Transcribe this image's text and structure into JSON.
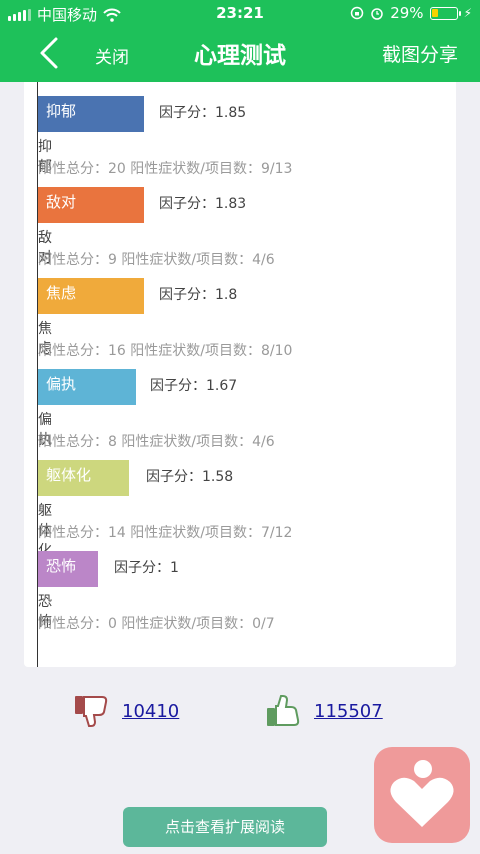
{
  "status_bar": {
    "carrier": "中国移动",
    "time": "23:21",
    "battery": "29%",
    "battery_level": 0.29
  },
  "nav": {
    "close_label": "关闭",
    "title": "心理测试",
    "share_label": "截图分享"
  },
  "factors": [
    {
      "bar_label": "抑郁",
      "score_text": "因子分：1.85",
      "name": "抑郁",
      "stats": "阳性总分：20    阳性症状数/项目数：9/13",
      "color": "#4a73b1",
      "bar_fraction": 0.2333
    },
    {
      "bar_label": "敌对",
      "score_text": "因子分：1.83",
      "name": "敌对",
      "stats": "阳性总分：9    阳性症状数/项目数：4/6",
      "color": "#e9743e",
      "bar_fraction": 0.2333
    },
    {
      "bar_label": "焦虑",
      "score_text": "因子分：1.8",
      "name": "焦虑",
      "stats": "阳性总分：16    阳性症状数/项目数：8/10",
      "color": "#f0aa3b",
      "bar_fraction": 0.2333
    },
    {
      "bar_label": "偏执",
      "score_text": "因子分：1.67",
      "name": "偏执",
      "stats": "阳性总分：8    阳性症状数/项目数：4/6",
      "color": "#5eb4d6",
      "bar_fraction": 0.2167
    },
    {
      "bar_label": "躯体化",
      "score_text": "因子分：1.58",
      "name": "躯体化",
      "stats": "阳性总分：14    阳性症状数/项目数：7/12",
      "color": "#cdd77e",
      "bar_fraction": 0.2
    },
    {
      "bar_label": "恐怖",
      "score_text": "因子分：1",
      "name": "恐怖",
      "stats": "阳性总分：0    阳性症状数/项目数：0/7",
      "color": "#bb86c8",
      "bar_fraction": 0.1333
    }
  ],
  "votes": {
    "dislike_count": "10410",
    "like_count": "115507"
  },
  "expand_button": "点击查看扩展阅读",
  "icons": [
    "back-chevron-icon",
    "wifi-icon",
    "rotation-lock-icon",
    "alarm-icon",
    "battery-icon",
    "thumbs-down-icon",
    "thumbs-up-icon",
    "heart-app-icon"
  ]
}
